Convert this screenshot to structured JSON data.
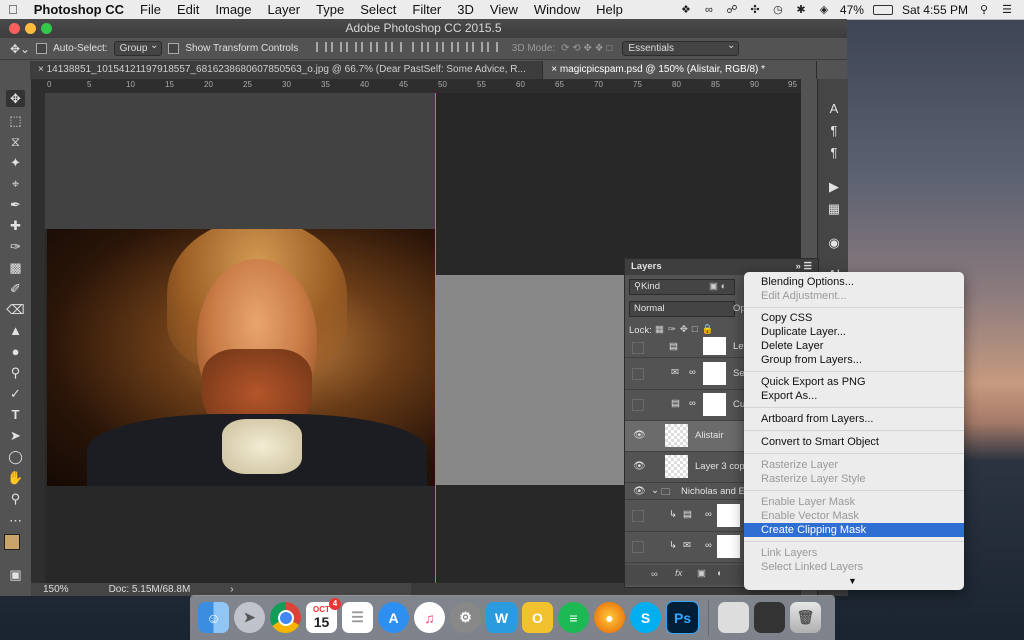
{
  "menubar": {
    "app": "Photoshop CC",
    "items": [
      "File",
      "Edit",
      "Image",
      "Layer",
      "Type",
      "Select",
      "Filter",
      "3D",
      "View",
      "Window",
      "Help"
    ],
    "battery": "47%",
    "clock": "Sat 4:55 PM"
  },
  "window": {
    "title": "Adobe Photoshop CC 2015.5"
  },
  "options": {
    "auto_select_label": "Auto-Select:",
    "auto_select_value": "Group",
    "show_transform_label": "Show Transform Controls",
    "mode_3d_label": "3D Mode:",
    "workspace": "Essentials"
  },
  "tabs": [
    {
      "label": "14138851_10154121197918557_6816238680607850563_o.jpg @ 66.7% (Dear  PastSelf: Some  Advice, R..."
    },
    {
      "label": "magicpicspam.psd @ 150% (Alistair, RGB/8) *"
    }
  ],
  "ruler": {
    "ticks": [
      "0",
      "5",
      "10",
      "15",
      "20",
      "25",
      "30",
      "35",
      "40",
      "45",
      "50",
      "55",
      "60",
      "65",
      "70",
      "75",
      "80",
      "85",
      "90",
      "95"
    ]
  },
  "status": {
    "zoom": "150%",
    "doc": "Doc: 5.15M/68.8M"
  },
  "layers_panel": {
    "title": "Layers",
    "kind_label": "Kind",
    "blend_mode": "Normal",
    "opacity_label": "Op",
    "lock_label": "Lock:",
    "rows": [
      {
        "name": "Lev",
        "visible": false
      },
      {
        "name": "Se",
        "visible": false
      },
      {
        "name": "Cu",
        "visible": false
      },
      {
        "name": "Alistair",
        "visible": true
      },
      {
        "name": "Layer 3 copy",
        "visible": true
      },
      {
        "name": "Nicholas and Es",
        "visible": true
      },
      {
        "name": "",
        "visible": false
      },
      {
        "name": "",
        "visible": false
      }
    ],
    "footer_fx": "fx"
  },
  "context_menu": {
    "items": [
      {
        "label": "Blending Options...",
        "enabled": true
      },
      {
        "label": "Edit Adjustment...",
        "enabled": false
      },
      {
        "label": "Copy CSS",
        "enabled": true
      },
      {
        "label": "Duplicate Layer...",
        "enabled": true
      },
      {
        "label": "Delete Layer",
        "enabled": true
      },
      {
        "label": "Group from Layers...",
        "enabled": true
      },
      {
        "label": "Quick Export as PNG",
        "enabled": true
      },
      {
        "label": "Export As...",
        "enabled": true
      },
      {
        "label": "Artboard from Layers...",
        "enabled": true
      },
      {
        "label": "Convert to Smart Object",
        "enabled": true
      },
      {
        "label": "Rasterize Layer",
        "enabled": false
      },
      {
        "label": "Rasterize Layer Style",
        "enabled": false
      },
      {
        "label": "Enable Layer Mask",
        "enabled": false
      },
      {
        "label": "Enable Vector Mask",
        "enabled": false
      },
      {
        "label": "Create Clipping Mask",
        "enabled": true,
        "highlighted": true
      },
      {
        "label": "Link Layers",
        "enabled": false
      },
      {
        "label": "Select Linked Layers",
        "enabled": false
      }
    ],
    "highlight_color": "#2f6fd3"
  },
  "dock": {
    "calendar_month": "OCT",
    "calendar_day": "15",
    "calendar_badge": "4",
    "apps": [
      "finder",
      "launchpad",
      "chrome",
      "calendar",
      "reminders",
      "app-store",
      "itunes",
      "system-preferences",
      "writer",
      "outlook",
      "spotify",
      "firefox",
      "skype",
      "photoshop",
      "photo",
      "media",
      "trash"
    ]
  }
}
